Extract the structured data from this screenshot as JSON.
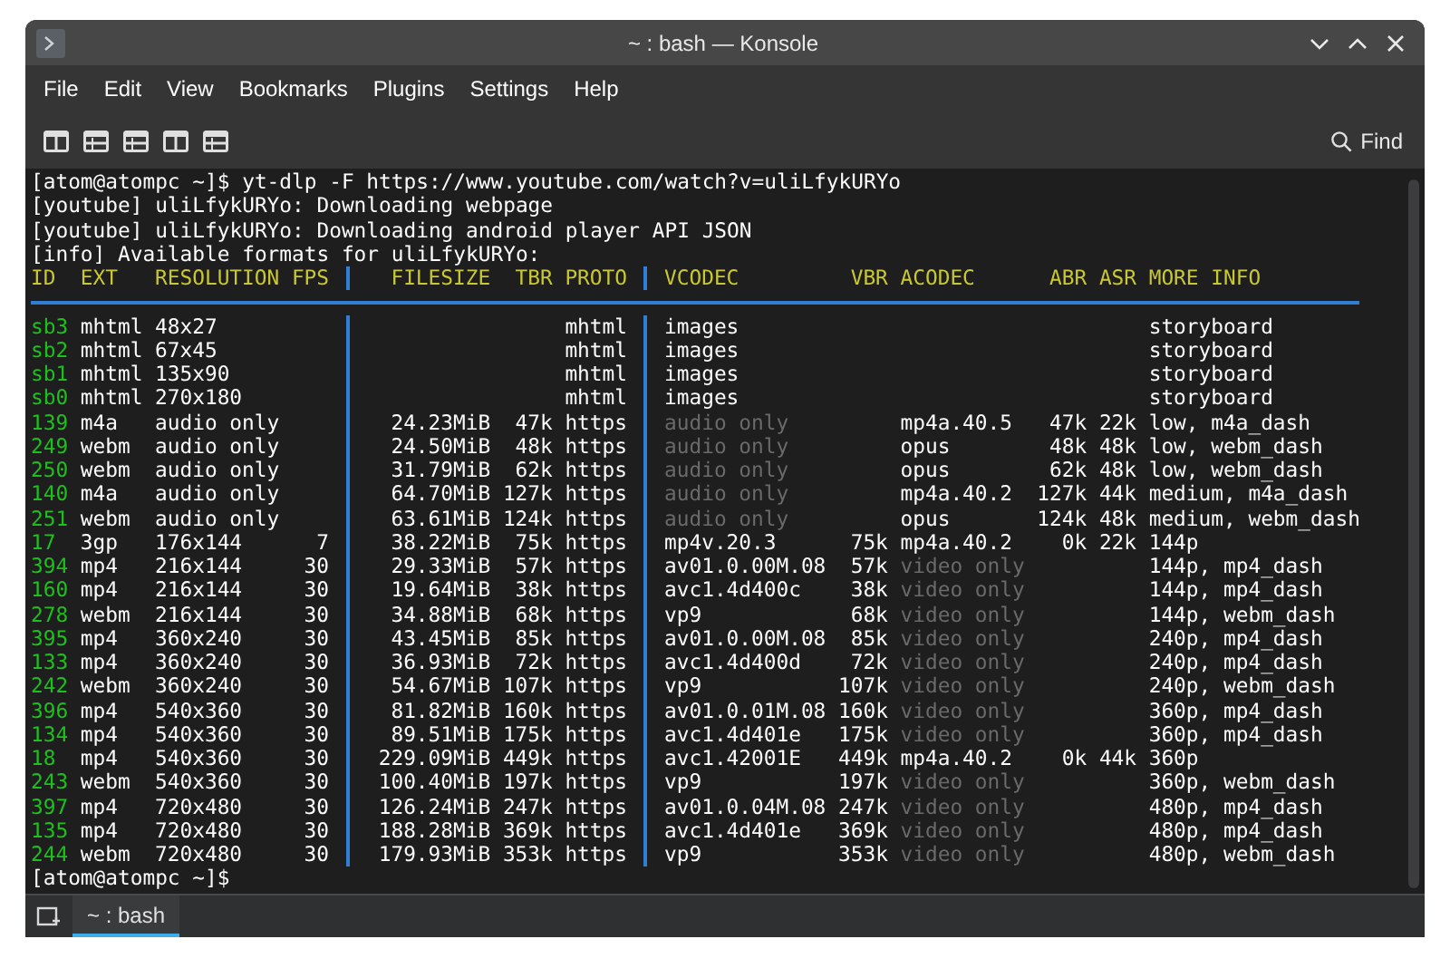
{
  "window": {
    "title": "~ : bash — Konsole"
  },
  "menu": [
    "File",
    "Edit",
    "View",
    "Bookmarks",
    "Plugins",
    "Settings",
    "Help"
  ],
  "toolbar": {
    "find": "Find"
  },
  "terminal": {
    "lines": [
      "[atom@atompc ~]$ yt-dlp -F https://www.youtube.com/watch?v=uliLfykURYo",
      "[youtube] uliLfykURYo: Downloading webpage",
      "[youtube] uliLfykURYo: Downloading android player API JSON",
      "[info] Available formats for uliLfykURYo:"
    ],
    "header": {
      "id": "ID",
      "ext": "EXT",
      "resolution": "RESOLUTION",
      "fps": "FPS",
      "filesize": "FILESIZE",
      "tbr": "TBR",
      "proto": "PROTO",
      "vcodec": "VCODEC",
      "vbr": "VBR",
      "acodec": "ACODEC",
      "abr": "ABR",
      "asr": "ASR",
      "more_info": "MORE INFO"
    },
    "rows": [
      {
        "id": "sb3",
        "ext": "mhtml",
        "resolution": "48x27",
        "proto": "mhtml",
        "vcodec": "images",
        "vcodec_dim": false,
        "more_info": "storyboard"
      },
      {
        "id": "sb2",
        "ext": "mhtml",
        "resolution": "67x45",
        "proto": "mhtml",
        "vcodec": "images",
        "vcodec_dim": false,
        "more_info": "storyboard"
      },
      {
        "id": "sb1",
        "ext": "mhtml",
        "resolution": "135x90",
        "proto": "mhtml",
        "vcodec": "images",
        "vcodec_dim": false,
        "more_info": "storyboard"
      },
      {
        "id": "sb0",
        "ext": "mhtml",
        "resolution": "270x180",
        "proto": "mhtml",
        "vcodec": "images",
        "vcodec_dim": false,
        "more_info": "storyboard"
      },
      {
        "id": "139",
        "ext": "m4a",
        "resolution": "audio only",
        "filesize": "24.23MiB",
        "tbr": "47k",
        "proto": "https",
        "vcodec": "audio only",
        "vcodec_dim": true,
        "acodec": "mp4a.40.5",
        "acodec_dim": false,
        "abr": "47k",
        "asr": "22k",
        "more_info": "low, m4a_dash"
      },
      {
        "id": "249",
        "ext": "webm",
        "resolution": "audio only",
        "filesize": "24.50MiB",
        "tbr": "48k",
        "proto": "https",
        "vcodec": "audio only",
        "vcodec_dim": true,
        "acodec": "opus",
        "acodec_dim": false,
        "abr": "48k",
        "asr": "48k",
        "more_info": "low, webm_dash"
      },
      {
        "id": "250",
        "ext": "webm",
        "resolution": "audio only",
        "filesize": "31.79MiB",
        "tbr": "62k",
        "proto": "https",
        "vcodec": "audio only",
        "vcodec_dim": true,
        "acodec": "opus",
        "acodec_dim": false,
        "abr": "62k",
        "asr": "48k",
        "more_info": "low, webm_dash"
      },
      {
        "id": "140",
        "ext": "m4a",
        "resolution": "audio only",
        "filesize": "64.70MiB",
        "tbr": "127k",
        "proto": "https",
        "vcodec": "audio only",
        "vcodec_dim": true,
        "acodec": "mp4a.40.2",
        "acodec_dim": false,
        "abr": "127k",
        "asr": "44k",
        "more_info": "medium, m4a_dash"
      },
      {
        "id": "251",
        "ext": "webm",
        "resolution": "audio only",
        "filesize": "63.61MiB",
        "tbr": "124k",
        "proto": "https",
        "vcodec": "audio only",
        "vcodec_dim": true,
        "acodec": "opus",
        "acodec_dim": false,
        "abr": "124k",
        "asr": "48k",
        "more_info": "medium, webm_dash"
      },
      {
        "id": "17",
        "ext": "3gp",
        "resolution": "176x144",
        "fps": "7",
        "filesize": "38.22MiB",
        "tbr": "75k",
        "proto": "https",
        "vcodec": "mp4v.20.3",
        "vcodec_dim": false,
        "vbr": "75k",
        "acodec": "mp4a.40.2",
        "acodec_dim": false,
        "abr": "0k",
        "asr": "22k",
        "more_info": "144p"
      },
      {
        "id": "394",
        "ext": "mp4",
        "resolution": "216x144",
        "fps": "30",
        "filesize": "29.33MiB",
        "tbr": "57k",
        "proto": "https",
        "vcodec": "av01.0.00M.08",
        "vcodec_dim": false,
        "vbr": "57k",
        "acodec": "video only",
        "acodec_dim": true,
        "more_info": "144p, mp4_dash"
      },
      {
        "id": "160",
        "ext": "mp4",
        "resolution": "216x144",
        "fps": "30",
        "filesize": "19.64MiB",
        "tbr": "38k",
        "proto": "https",
        "vcodec": "avc1.4d400c",
        "vcodec_dim": false,
        "vbr": "38k",
        "acodec": "video only",
        "acodec_dim": true,
        "more_info": "144p, mp4_dash"
      },
      {
        "id": "278",
        "ext": "webm",
        "resolution": "216x144",
        "fps": "30",
        "filesize": "34.88MiB",
        "tbr": "68k",
        "proto": "https",
        "vcodec": "vp9",
        "vcodec_dim": false,
        "vbr": "68k",
        "acodec": "video only",
        "acodec_dim": true,
        "more_info": "144p, webm_dash"
      },
      {
        "id": "395",
        "ext": "mp4",
        "resolution": "360x240",
        "fps": "30",
        "filesize": "43.45MiB",
        "tbr": "85k",
        "proto": "https",
        "vcodec": "av01.0.00M.08",
        "vcodec_dim": false,
        "vbr": "85k",
        "acodec": "video only",
        "acodec_dim": true,
        "more_info": "240p, mp4_dash"
      },
      {
        "id": "133",
        "ext": "mp4",
        "resolution": "360x240",
        "fps": "30",
        "filesize": "36.93MiB",
        "tbr": "72k",
        "proto": "https",
        "vcodec": "avc1.4d400d",
        "vcodec_dim": false,
        "vbr": "72k",
        "acodec": "video only",
        "acodec_dim": true,
        "more_info": "240p, mp4_dash"
      },
      {
        "id": "242",
        "ext": "webm",
        "resolution": "360x240",
        "fps": "30",
        "filesize": "54.67MiB",
        "tbr": "107k",
        "proto": "https",
        "vcodec": "vp9",
        "vcodec_dim": false,
        "vbr": "107k",
        "acodec": "video only",
        "acodec_dim": true,
        "more_info": "240p, webm_dash"
      },
      {
        "id": "396",
        "ext": "mp4",
        "resolution": "540x360",
        "fps": "30",
        "filesize": "81.82MiB",
        "tbr": "160k",
        "proto": "https",
        "vcodec": "av01.0.01M.08",
        "vcodec_dim": false,
        "vbr": "160k",
        "acodec": "video only",
        "acodec_dim": true,
        "more_info": "360p, mp4_dash"
      },
      {
        "id": "134",
        "ext": "mp4",
        "resolution": "540x360",
        "fps": "30",
        "filesize": "89.51MiB",
        "tbr": "175k",
        "proto": "https",
        "vcodec": "avc1.4d401e",
        "vcodec_dim": false,
        "vbr": "175k",
        "acodec": "video only",
        "acodec_dim": true,
        "more_info": "360p, mp4_dash"
      },
      {
        "id": "18",
        "ext": "mp4",
        "resolution": "540x360",
        "fps": "30",
        "filesize": "229.09MiB",
        "tbr": "449k",
        "proto": "https",
        "vcodec": "avc1.42001E",
        "vcodec_dim": false,
        "vbr": "449k",
        "acodec": "mp4a.40.2",
        "acodec_dim": false,
        "abr": "0k",
        "asr": "44k",
        "more_info": "360p"
      },
      {
        "id": "243",
        "ext": "webm",
        "resolution": "540x360",
        "fps": "30",
        "filesize": "100.40MiB",
        "tbr": "197k",
        "proto": "https",
        "vcodec": "vp9",
        "vcodec_dim": false,
        "vbr": "197k",
        "acodec": "video only",
        "acodec_dim": true,
        "more_info": "360p, webm_dash"
      },
      {
        "id": "397",
        "ext": "mp4",
        "resolution": "720x480",
        "fps": "30",
        "filesize": "126.24MiB",
        "tbr": "247k",
        "proto": "https",
        "vcodec": "av01.0.04M.08",
        "vcodec_dim": false,
        "vbr": "247k",
        "acodec": "video only",
        "acodec_dim": true,
        "more_info": "480p, mp4_dash"
      },
      {
        "id": "135",
        "ext": "mp4",
        "resolution": "720x480",
        "fps": "30",
        "filesize": "188.28MiB",
        "tbr": "369k",
        "proto": "https",
        "vcodec": "avc1.4d401e",
        "vcodec_dim": false,
        "vbr": "369k",
        "acodec": "video only",
        "acodec_dim": true,
        "more_info": "480p, mp4_dash"
      },
      {
        "id": "244",
        "ext": "webm",
        "resolution": "720x480",
        "fps": "30",
        "filesize": "179.93MiB",
        "tbr": "353k",
        "proto": "https",
        "vcodec": "vp9",
        "vcodec_dim": false,
        "vbr": "353k",
        "acodec": "video only",
        "acodec_dim": true,
        "more_info": "480p, webm_dash"
      }
    ],
    "prompt": "[atom@atompc ~]$"
  },
  "tabs": [
    {
      "label": "~ : bash",
      "selected": true
    }
  ]
}
